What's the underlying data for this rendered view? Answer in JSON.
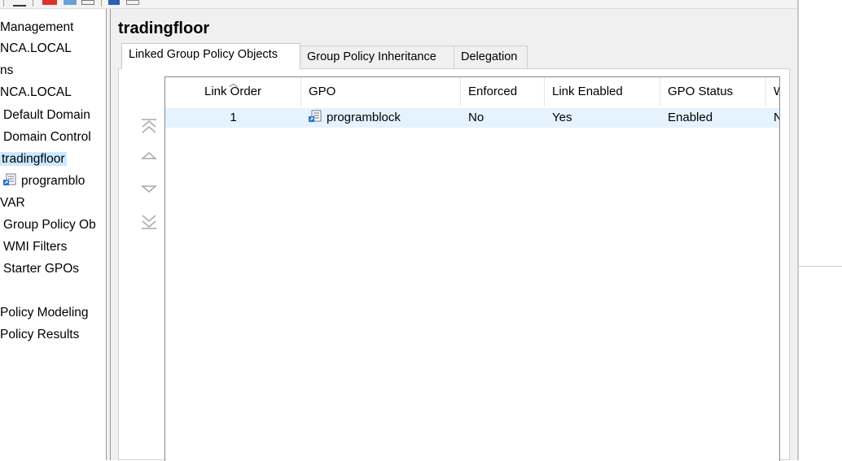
{
  "tree": {
    "items": [
      {
        "label": "Management"
      },
      {
        "label": "NCA.LOCAL"
      },
      {
        "label": "ns"
      },
      {
        "label": "NCA.LOCAL"
      },
      {
        "label": "Default Domain"
      },
      {
        "label": "Domain Control"
      },
      {
        "label": "tradingfloor",
        "selected": true
      },
      {
        "label": "programblo",
        "icon": "gpo-link-icon"
      },
      {
        "label": "VAR"
      },
      {
        "label": "Group Policy Ob"
      },
      {
        "label": "WMI Filters"
      },
      {
        "label": "Starter GPOs"
      },
      {
        "label": "Policy Modeling"
      },
      {
        "label": "Policy Results"
      }
    ]
  },
  "panel": {
    "title": "tradingfloor",
    "tabs": [
      {
        "label": "Linked Group Policy Objects",
        "active": true
      },
      {
        "label": "Group Policy Inheritance"
      },
      {
        "label": "Delegation"
      }
    ]
  },
  "reorder_buttons": [
    "move-top-icon",
    "move-up-icon",
    "move-down-icon",
    "move-bottom-icon"
  ],
  "table": {
    "columns": [
      "Link Order",
      "GPO",
      "Enforced",
      "Link Enabled",
      "GPO Status",
      "W"
    ],
    "rows": [
      {
        "link_order": "1",
        "gpo": "programblock",
        "enforced": "No",
        "link_enabled": "Yes",
        "gpo_status": "Enabled",
        "w": "N"
      }
    ]
  },
  "colors": {
    "selection": "#cce8ff",
    "row_highlight": "#e5f3ff",
    "panel_bg": "#f0f0f0"
  }
}
